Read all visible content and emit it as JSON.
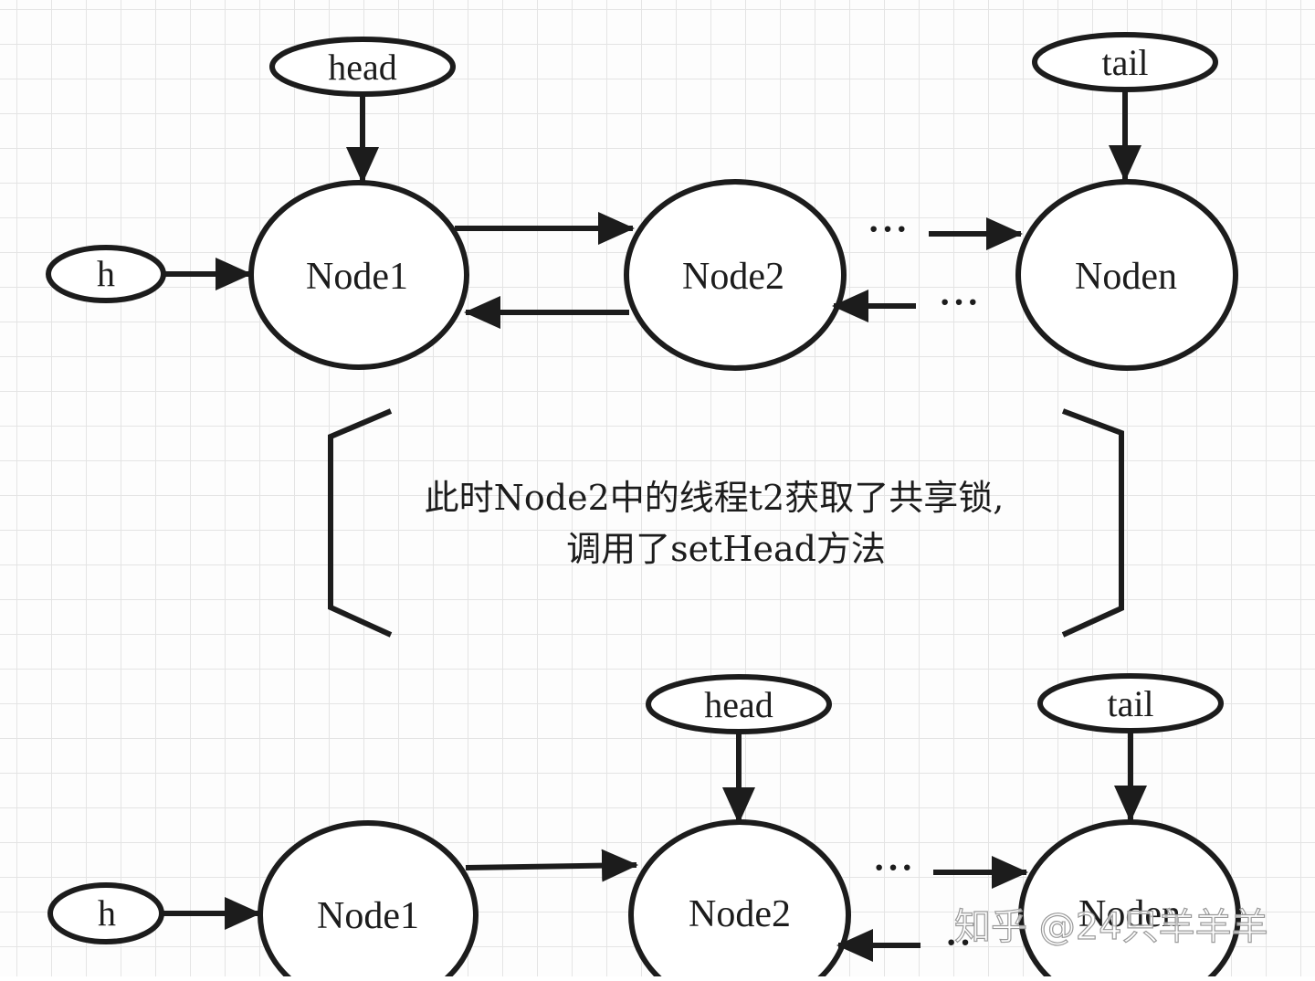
{
  "top_diagram": {
    "pointer_head": "head",
    "pointer_tail": "tail",
    "pointer_h": "h",
    "nodes": [
      "Node1",
      "Node2",
      "Noden"
    ],
    "dots_forward": "···",
    "dots_backward": "···"
  },
  "note": {
    "line1": "此时Node2中的线程t2获取了共享锁,",
    "line2": "调用了setHead方法"
  },
  "bottom_diagram": {
    "pointer_head": "head",
    "pointer_tail": "tail",
    "pointer_h": "h",
    "nodes": [
      "Node1",
      "Node2",
      "Noden"
    ],
    "dots_forward": "···",
    "dots_backward": "··"
  },
  "watermark": "知乎 @24只羊羊羊",
  "colors": {
    "stroke": "#1c1c1c",
    "grid": "#e4e4e4",
    "background": "#fdfdfd"
  }
}
